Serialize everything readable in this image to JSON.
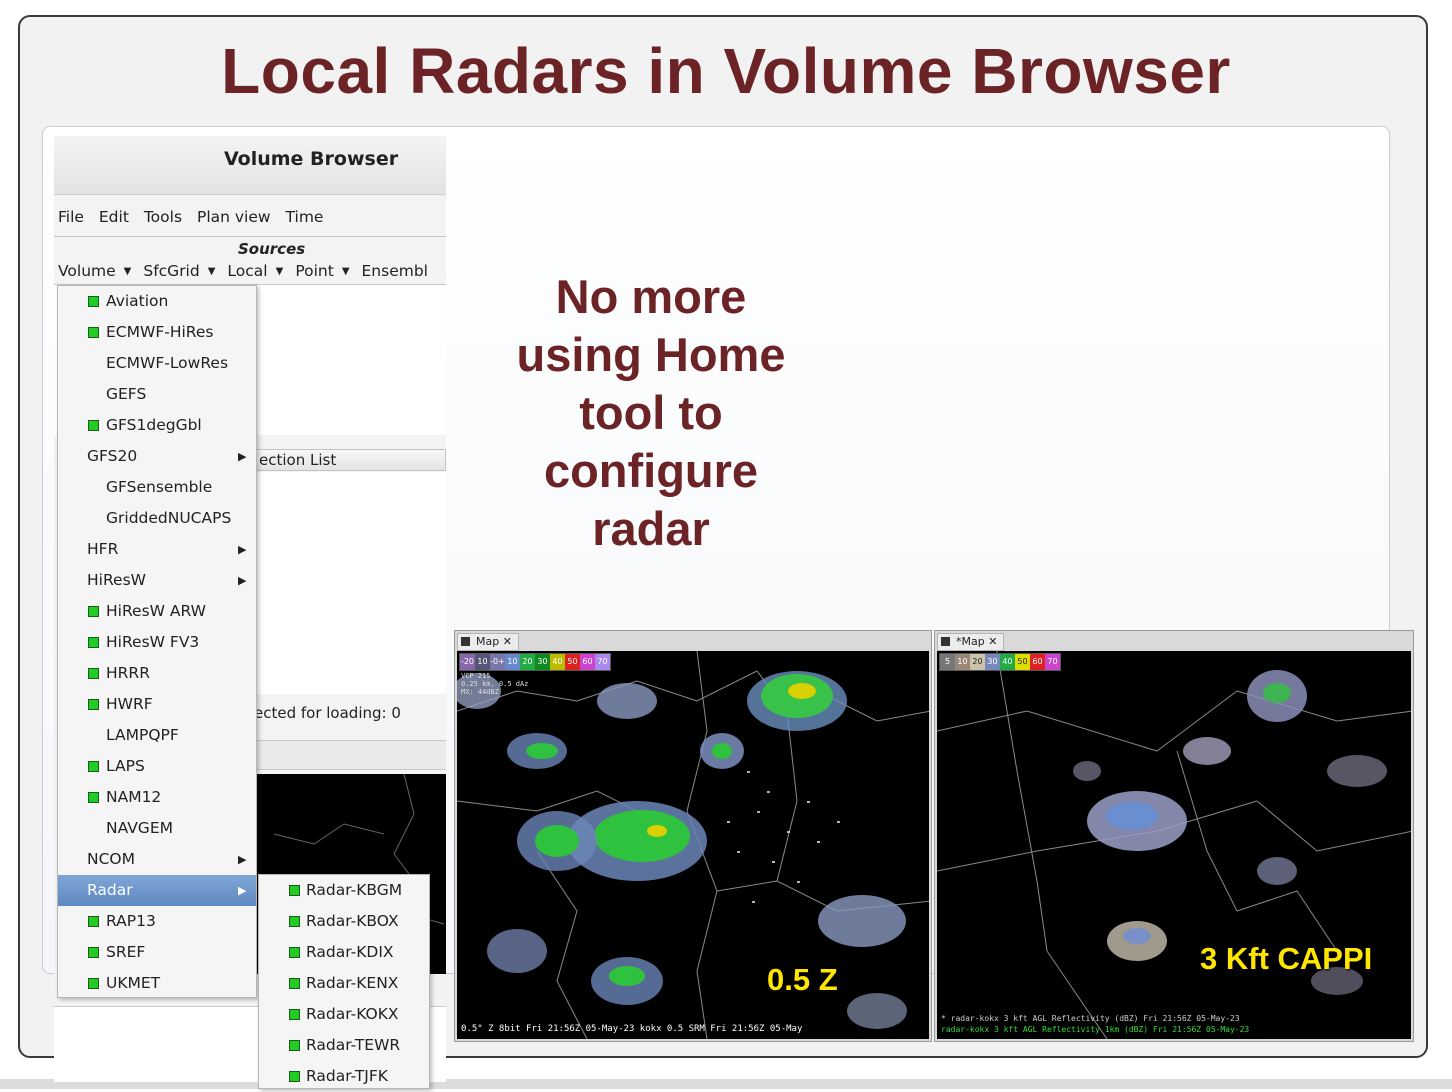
{
  "slide": {
    "title": "Local Radars in Volume Browser"
  },
  "volume_browser": {
    "title": "Volume Browser",
    "menu": [
      "File",
      "Edit",
      "Tools",
      "Plan view",
      "Time"
    ],
    "sources_heading": "Sources",
    "source_dropdowns": [
      "Volume",
      "SfcGrid",
      "Local",
      "Point",
      "Ensembl"
    ],
    "selection_list_header": "ection List",
    "loading_status": "ected for loading:  0"
  },
  "volume_menu": {
    "items": [
      {
        "label": "Aviation",
        "status": "green",
        "submenu": false
      },
      {
        "label": "ECMWF-HiRes",
        "status": "green",
        "submenu": false
      },
      {
        "label": "ECMWF-LowRes",
        "status": "none",
        "submenu": false
      },
      {
        "label": "GEFS",
        "status": "none",
        "submenu": false
      },
      {
        "label": "GFS1degGbl",
        "status": "green",
        "submenu": false
      },
      {
        "label": "GFS20",
        "status": "folder",
        "submenu": true
      },
      {
        "label": "GFSensemble",
        "status": "none",
        "submenu": false
      },
      {
        "label": "GriddedNUCAPS",
        "status": "none",
        "submenu": false
      },
      {
        "label": "HFR",
        "status": "folder",
        "submenu": true
      },
      {
        "label": "HiResW",
        "status": "folder",
        "submenu": true
      },
      {
        "label": "HiResW ARW",
        "status": "green",
        "submenu": false
      },
      {
        "label": "HiResW FV3",
        "status": "green",
        "submenu": false
      },
      {
        "label": "HRRR",
        "status": "green",
        "submenu": false
      },
      {
        "label": "HWRF",
        "status": "green",
        "submenu": false
      },
      {
        "label": "LAMPQPF",
        "status": "none",
        "submenu": false
      },
      {
        "label": "LAPS",
        "status": "green",
        "submenu": false
      },
      {
        "label": "NAM12",
        "status": "green",
        "submenu": false
      },
      {
        "label": "NAVGEM",
        "status": "none",
        "submenu": false
      },
      {
        "label": "NCOM",
        "status": "folder",
        "submenu": true
      },
      {
        "label": "Radar",
        "status": "folder",
        "submenu": true,
        "active": true
      },
      {
        "label": "RAP13",
        "status": "green",
        "submenu": false
      },
      {
        "label": "SREF",
        "status": "green",
        "submenu": false
      },
      {
        "label": "UKMET",
        "status": "green",
        "submenu": false
      }
    ]
  },
  "radar_submenu": {
    "items": [
      "Radar-KBGM",
      "Radar-KBOX",
      "Radar-KDIX",
      "Radar-KENX",
      "Radar-KOKX",
      "Radar-TEWR",
      "Radar-TJFK"
    ]
  },
  "callout": {
    "lines": [
      "No more",
      "using Home",
      "tool to",
      "configure",
      "radar"
    ]
  },
  "panes": {
    "left": {
      "tab": "Map",
      "colorbar": [
        "-20",
        "10",
        "-0+",
        "10",
        "20",
        "30",
        "40",
        "50",
        "60",
        "70"
      ],
      "info": "VCP 215\n0.25 km, 0.5 dAz\nMX: 44dBZ",
      "bottom_line": "0.5° Z 8bit  Fri 21:56Z 05-May-23   kokx 0.5  SRM  Fri 21:56Z 05-May",
      "overlay_label": "0.5 Z"
    },
    "right": {
      "tab": "*Map",
      "colorbar": [
        "5",
        "10",
        "20",
        "30",
        "40",
        "50",
        "60",
        "70"
      ],
      "bottom_line1": "* radar-kokx 3 kft AGL Reflectivity (dBZ)    Fri 21:56Z 05-May-23",
      "bottom_line2": "radar-kokx 3 kft AGL Reflectivity 1km (dBZ)   Fri 21:56Z 05-May-23",
      "overlay_label": "3 Kft CAPPI"
    }
  },
  "colors": {
    "title": "#6b2326",
    "overlay": "#ffe600",
    "menu_active": "#6a90c8",
    "status_green": "#22cc22"
  }
}
